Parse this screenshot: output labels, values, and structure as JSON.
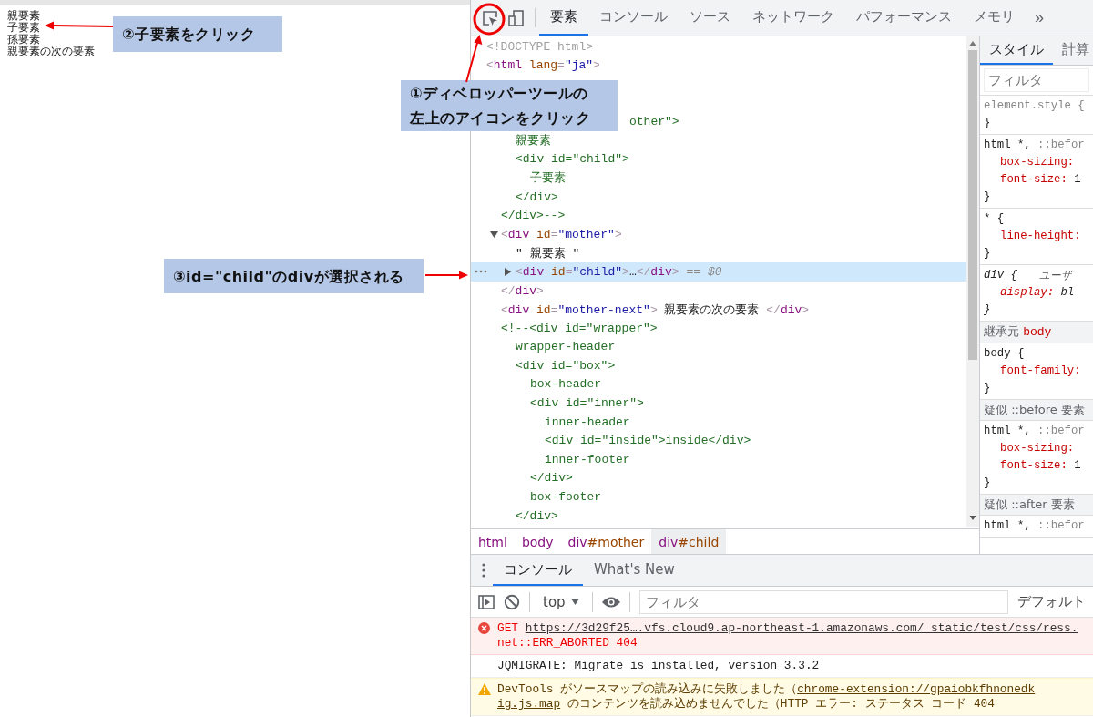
{
  "left_page": {
    "lines": [
      "親要素",
      "子要素",
      "孫要素",
      "親要素の次の要素"
    ]
  },
  "devtools": {
    "toolbar": {
      "tabs": [
        {
          "label": "要素",
          "selected": true
        },
        {
          "label": "コンソール",
          "selected": false
        },
        {
          "label": "ソース",
          "selected": false
        },
        {
          "label": "ネットワーク",
          "selected": false
        },
        {
          "label": "パフォーマンス",
          "selected": false
        },
        {
          "label": "メモリ",
          "selected": false
        }
      ],
      "more_tabs": "»"
    },
    "dom_tree": [
      {
        "kind": "doctype",
        "text": "<!DOCTYPE html>",
        "selected": false
      },
      {
        "kind": "tag",
        "text": "<html lang=\"ja\">",
        "selected": false,
        "children": [
          {
            "kind": "cut",
            "text": "other\">",
            "selected": false,
            "children": [
              {
                "kind": "comment",
                "text": "親要素",
                "selected": false
              },
              {
                "kind": "comment",
                "text": "<div id=\"child\">",
                "selected": false,
                "children": [
                  {
                    "kind": "comment",
                    "text": "子要素",
                    "selected": false
                  }
                ]
              },
              {
                "kind": "comment",
                "text": "</div>",
                "selected": false
              }
            ]
          },
          {
            "kind": "comment",
            "text": "</div>-->",
            "selected": false
          },
          {
            "kind": "tag",
            "text": "<div id=\"mother\">",
            "expanded": true,
            "selected": false,
            "children": [
              {
                "kind": "text",
                "text": "\" 親要素 \"",
                "selected": false
              },
              {
                "kind": "tag",
                "text": "<div id=\"child\">…</div>",
                "expanded": false,
                "selected": true,
                "ref": "== $0"
              }
            ]
          },
          {
            "kind": "tag",
            "text": "</div>",
            "selected": false
          },
          {
            "kind": "tag",
            "text": "<div id=\"mother-next\"> 親要素の次の要素 </div>",
            "selected": false
          },
          {
            "kind": "comment",
            "text": "<!--<div id=\"wrapper\">",
            "selected": false,
            "children": [
              {
                "kind": "comment",
                "text": "wrapper-header",
                "selected": false
              },
              {
                "kind": "comment",
                "text": "<div id=\"box\">",
                "selected": false,
                "children": [
                  {
                    "kind": "comment",
                    "text": "box-header",
                    "selected": false
                  },
                  {
                    "kind": "comment",
                    "text": "<div id=\"inner\">",
                    "selected": false,
                    "children": [
                      {
                        "kind": "comment",
                        "text": "inner-header",
                        "selected": false
                      },
                      {
                        "kind": "comment",
                        "text": "<div id=\"inside\">inside</div>",
                        "selected": false
                      },
                      {
                        "kind": "comment",
                        "text": "inner-footer",
                        "selected": false
                      }
                    ]
                  },
                  {
                    "kind": "comment",
                    "text": "</div>",
                    "selected": false
                  },
                  {
                    "kind": "comment",
                    "text": "box-footer",
                    "selected": false
                  }
                ]
              },
              {
                "kind": "comment",
                "text": "</div>",
                "selected": false
              }
            ]
          }
        ]
      }
    ],
    "breadcrumbs": [
      {
        "label": "html",
        "selected": false
      },
      {
        "label": "body",
        "selected": false
      },
      {
        "label": "div#mother",
        "selected": false
      },
      {
        "label": "div#child",
        "selected": true
      }
    ],
    "styles": {
      "tabs": [
        {
          "label": "スタイル",
          "selected": true
        },
        {
          "label": "計算",
          "selected": false
        }
      ],
      "filter": {
        "placeholder": "フィルタ"
      },
      "sections": [
        {
          "kind": "inline",
          "selector": "element.style {",
          "user_agent": false,
          "close": "}"
        },
        {
          "kind": "rule",
          "selector": "html *, ",
          "pseudo": "::befor",
          "user_agent": false,
          "declarations": [
            {
              "property": "box-sizing:"
            },
            {
              "property": "font-size:",
              "value": "1"
            }
          ],
          "close": "}"
        },
        {
          "kind": "rule",
          "selector": "* {",
          "user_agent": false,
          "declarations": [
            {
              "property": "line-height:"
            }
          ],
          "close": "}"
        },
        {
          "kind": "rule",
          "selector": "div {",
          "origin": "ユーザ",
          "user_agent": true,
          "declarations": [
            {
              "property": "display:",
              "value": "bl"
            }
          ],
          "close": "}"
        },
        {
          "kind": "header",
          "label": "継承元",
          "element": "body"
        },
        {
          "kind": "rule",
          "selector": "body {",
          "user_agent": false,
          "declarations": [
            {
              "property": "font-family:"
            }
          ],
          "close": "}"
        },
        {
          "kind": "header",
          "label": "疑似 ::before 要素"
        },
        {
          "kind": "rule",
          "selector": "html *, ",
          "pseudo": "::befor",
          "user_agent": false,
          "declarations": [
            {
              "property": "box-sizing:"
            },
            {
              "property": "font-size:",
              "value": "1"
            }
          ],
          "close": "}"
        },
        {
          "kind": "header",
          "label": "疑似 ::after 要素"
        },
        {
          "kind": "rule",
          "selector": "html *, ",
          "pseudo": "::befor",
          "user_agent": false
        }
      ]
    },
    "drawer": {
      "tabs": [
        {
          "label": "コンソール",
          "selected": true
        },
        {
          "label": "What's New",
          "selected": false
        }
      ],
      "context": "top",
      "filter": {
        "placeholder": "フィルタ"
      },
      "levels": "デフォルト",
      "messages": [
        {
          "kind": "error",
          "lines": [
            [
              {
                "kind": "text",
                "text": "GET "
              },
              {
                "kind": "link",
                "text": "https://3d29f25….vfs.cloud9.ap-northeast-1.amazonaws.com/_static/test/css/ress."
              }
            ],
            [
              {
                "kind": "text",
                "text": "net::ERR_ABORTED 404"
              }
            ]
          ]
        },
        {
          "kind": "info",
          "lines": [
            [
              {
                "kind": "text",
                "text": "JQMIGRATE: Migrate is installed, version 3.3.2"
              }
            ]
          ]
        },
        {
          "kind": "warning",
          "lines": [
            [
              {
                "kind": "text",
                "text": "DevTools がソースマップの読み込みに失敗しました（"
              },
              {
                "kind": "link",
                "text": "chrome-extension://gpaiobkfhnonedk"
              }
            ],
            [
              {
                "kind": "link",
                "text": "ig.js.map"
              },
              {
                "kind": "text",
                "text": " のコンテンツを読み込めませんでした（HTTP エラー: ステータス コード 404"
              }
            ]
          ]
        }
      ]
    }
  },
  "annotations": [
    {
      "lines": [
        "②子要素をクリック"
      ]
    },
    {
      "lines": [
        "①ディベロッパーツールの",
        "左上のアイコンをクリック"
      ]
    },
    {
      "lines": [
        "③id=\"child\"のdivが選択される"
      ]
    }
  ]
}
